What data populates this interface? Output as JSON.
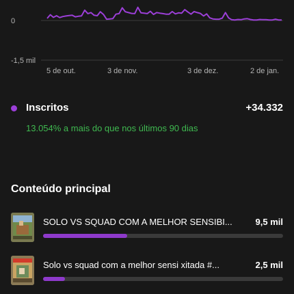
{
  "chart_data": {
    "type": "line",
    "y_tick_labels": [
      "0",
      "-1,5 mil"
    ],
    "x_tick_labels": [
      "5 de out.",
      "3 de nov.",
      "3 de dez.",
      "2 de jan."
    ],
    "series_color": "#9c3fd8",
    "values": [
      80,
      220,
      120,
      180,
      110,
      150,
      170,
      190,
      200,
      140,
      160,
      175,
      390,
      260,
      300,
      200,
      180,
      330,
      230,
      50,
      60,
      70,
      240,
      260,
      480,
      330,
      300,
      270,
      260,
      500,
      290,
      280,
      260,
      350,
      230,
      300,
      280,
      260,
      240,
      240,
      340,
      250,
      290,
      280,
      410,
      320,
      240,
      340,
      300,
      270,
      170,
      250,
      100,
      60,
      50,
      50,
      90,
      300,
      100,
      30,
      20,
      40,
      30,
      60,
      70,
      40,
      20,
      20,
      40,
      30,
      30,
      20,
      20,
      50,
      20,
      20
    ],
    "ylim": [
      -1500,
      600
    ]
  },
  "metric": {
    "name": "Inscritos",
    "value": "+34.332",
    "comparison": "13.054% a mais do que nos últimos 90 dias",
    "accent_color": "#9c3fd8"
  },
  "top_content": {
    "title": "Conteúdo principal",
    "items": [
      {
        "title": "SOLO VS SQUAD COM A MELHOR SENSIBI...",
        "value": "9,5 mil",
        "share": 0.35
      },
      {
        "title": "Solo vs squad com a melhor sensi xitada #...",
        "value": "2,5 mil",
        "share": 0.09
      }
    ]
  }
}
